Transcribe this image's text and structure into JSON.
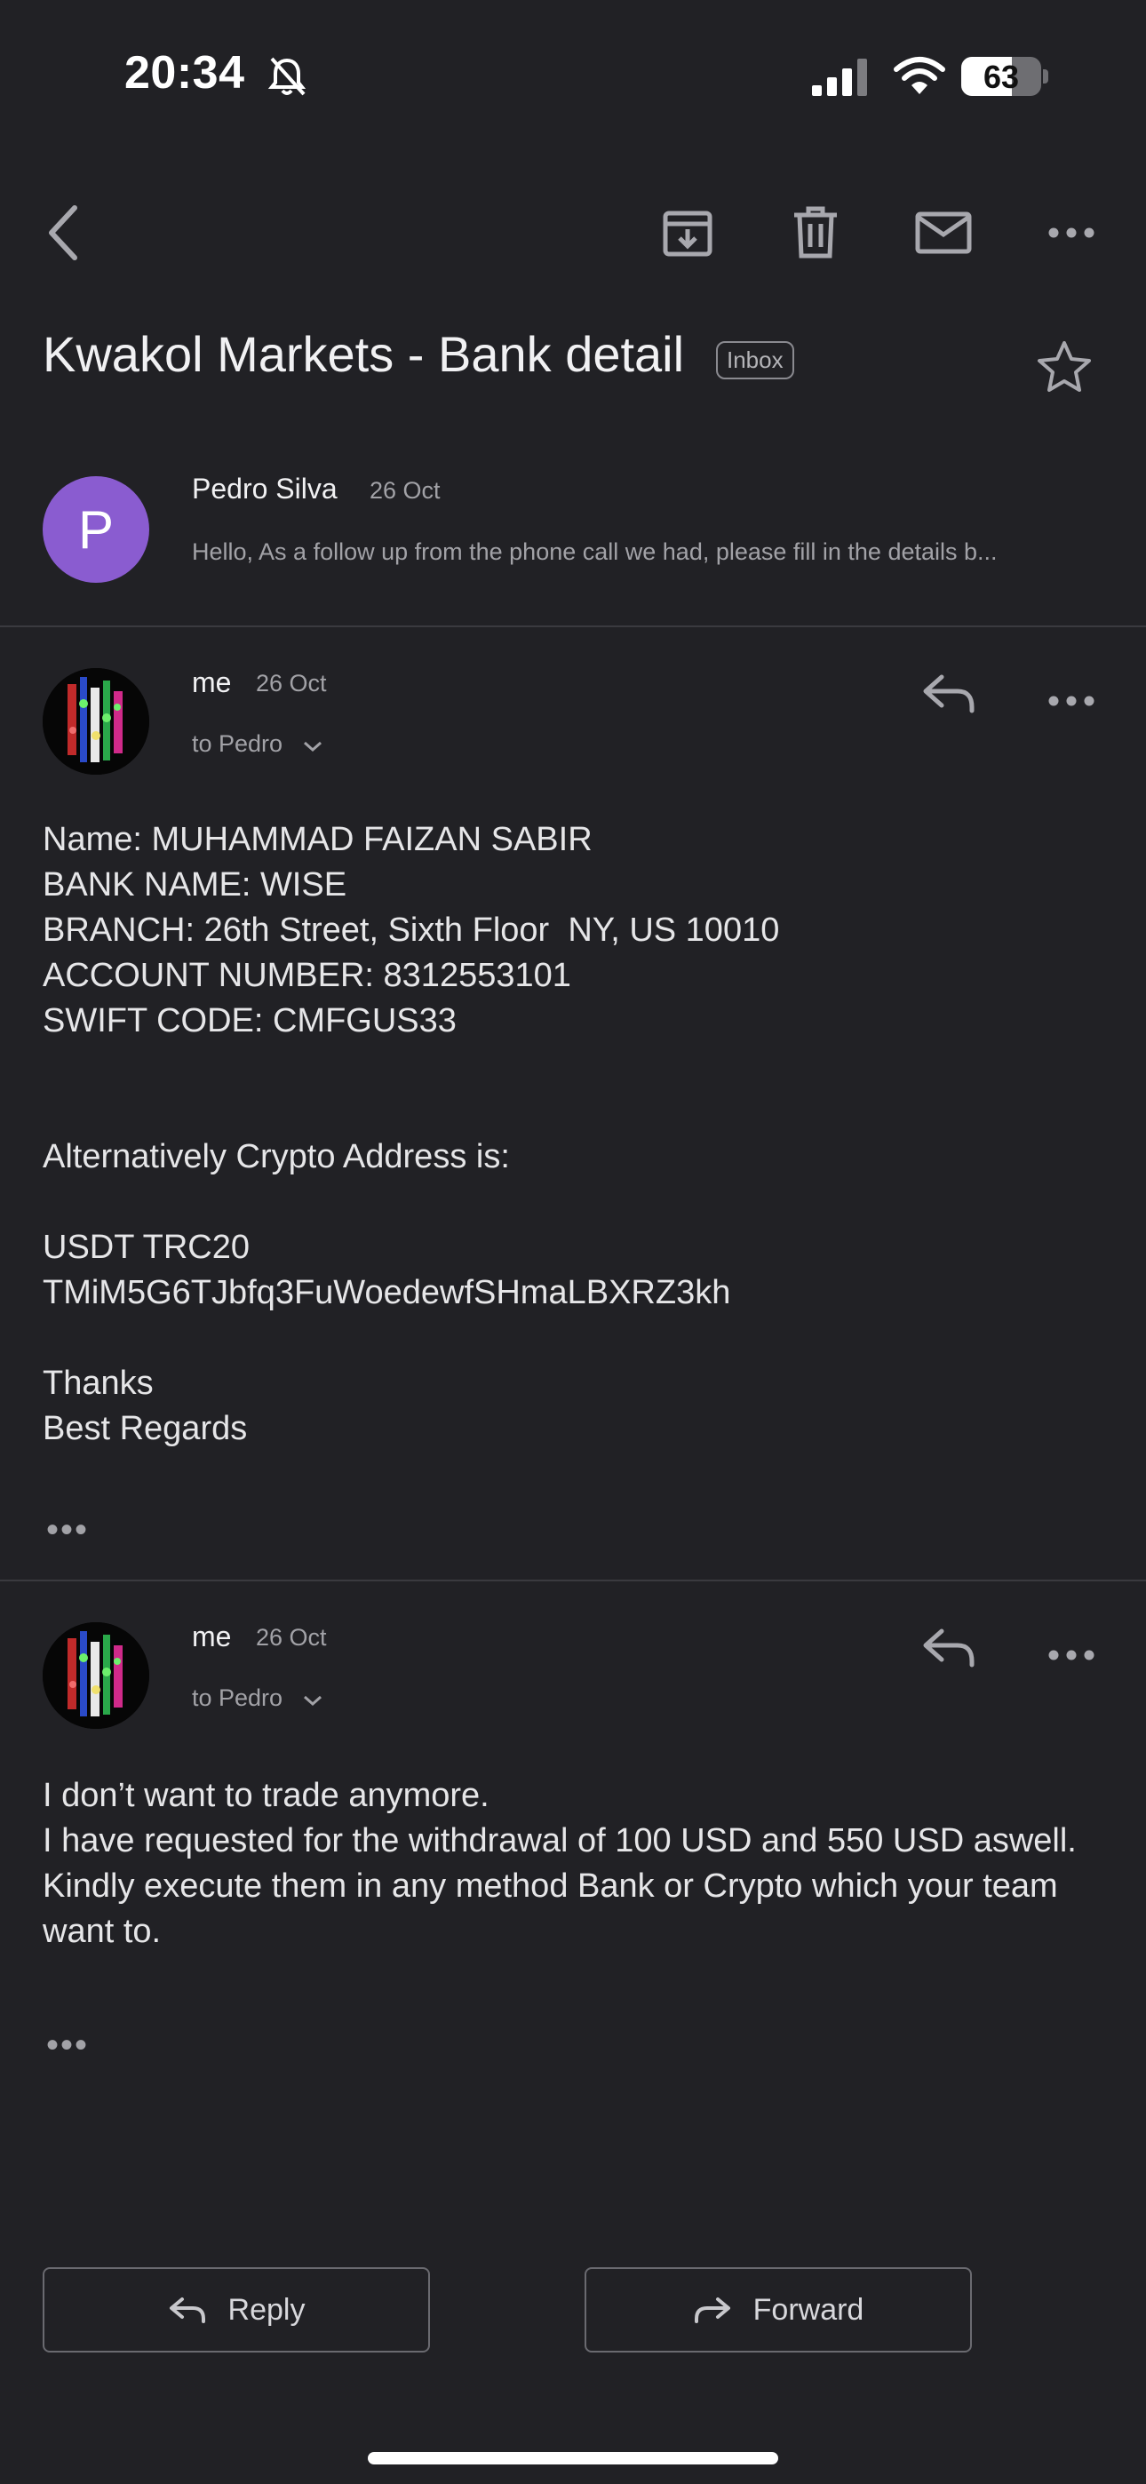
{
  "status_bar": {
    "time": "20:34",
    "battery": "63",
    "battery_level": 0.63
  },
  "email": {
    "subject": "Kwakol Markets - Bank detail",
    "label": "Inbox"
  },
  "messages": [
    {
      "avatar_letter": "P",
      "sender": "Pedro Silva",
      "date": "26 Oct",
      "preview": "Hello, As a follow up from the phone call we had, please fill in the details b..."
    },
    {
      "sender": "me",
      "date": "26 Oct",
      "to": "to Pedro",
      "body": "Name: MUHAMMAD FAIZAN SABIR\nBANK NAME: WISE\nBRANCH: 26th Street, Sixth Floor  NY, US 10010\nACCOUNT NUMBER: 8312553101\nSWIFT CODE: CMFGUS33\n\n\nAlternatively Crypto Address is:\n\nUSDT TRC20\nTMiM5G6TJbfq3FuWoedewfSHmaLBXRZ3kh\n\nThanks\nBest Regards",
      "more": "•••"
    },
    {
      "sender": "me",
      "date": "26 Oct",
      "to": "to Pedro",
      "body": "I don’t want to trade anymore.\nI have requested for the withdrawal of 100 USD and 550 USD aswell.\nKindly execute them in any method Bank or Crypto which your team want to.",
      "more": "•••"
    }
  ],
  "actions": {
    "reply": "Reply",
    "forward": "Forward"
  },
  "colors": {
    "background": "#212125",
    "avatar_purple": "#8a5cd0",
    "icon_gray": "#a8a8ae"
  }
}
